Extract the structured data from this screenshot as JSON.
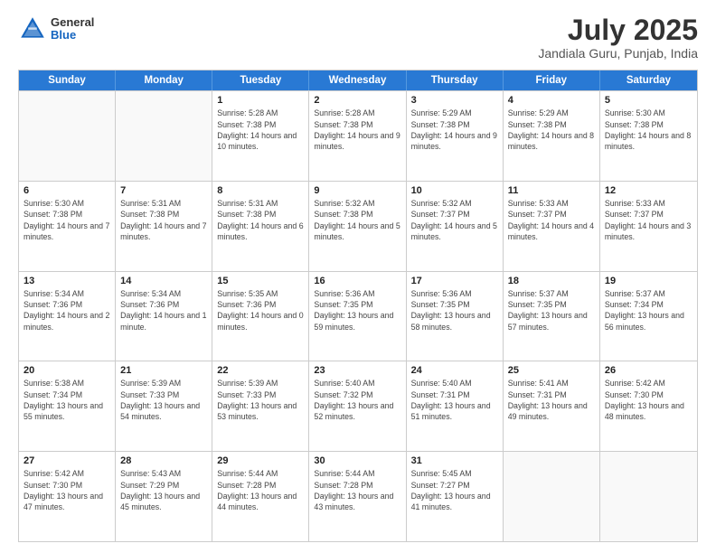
{
  "header": {
    "logo_general": "General",
    "logo_blue": "Blue",
    "main_title": "July 2025",
    "sub_title": "Jandiala Guru, Punjab, India"
  },
  "days_of_week": [
    "Sunday",
    "Monday",
    "Tuesday",
    "Wednesday",
    "Thursday",
    "Friday",
    "Saturday"
  ],
  "weeks": [
    [
      {
        "day": "",
        "info": ""
      },
      {
        "day": "",
        "info": ""
      },
      {
        "day": "1",
        "info": "Sunrise: 5:28 AM\nSunset: 7:38 PM\nDaylight: 14 hours and 10 minutes."
      },
      {
        "day": "2",
        "info": "Sunrise: 5:28 AM\nSunset: 7:38 PM\nDaylight: 14 hours and 9 minutes."
      },
      {
        "day": "3",
        "info": "Sunrise: 5:29 AM\nSunset: 7:38 PM\nDaylight: 14 hours and 9 minutes."
      },
      {
        "day": "4",
        "info": "Sunrise: 5:29 AM\nSunset: 7:38 PM\nDaylight: 14 hours and 8 minutes."
      },
      {
        "day": "5",
        "info": "Sunrise: 5:30 AM\nSunset: 7:38 PM\nDaylight: 14 hours and 8 minutes."
      }
    ],
    [
      {
        "day": "6",
        "info": "Sunrise: 5:30 AM\nSunset: 7:38 PM\nDaylight: 14 hours and 7 minutes."
      },
      {
        "day": "7",
        "info": "Sunrise: 5:31 AM\nSunset: 7:38 PM\nDaylight: 14 hours and 7 minutes."
      },
      {
        "day": "8",
        "info": "Sunrise: 5:31 AM\nSunset: 7:38 PM\nDaylight: 14 hours and 6 minutes."
      },
      {
        "day": "9",
        "info": "Sunrise: 5:32 AM\nSunset: 7:38 PM\nDaylight: 14 hours and 5 minutes."
      },
      {
        "day": "10",
        "info": "Sunrise: 5:32 AM\nSunset: 7:37 PM\nDaylight: 14 hours and 5 minutes."
      },
      {
        "day": "11",
        "info": "Sunrise: 5:33 AM\nSunset: 7:37 PM\nDaylight: 14 hours and 4 minutes."
      },
      {
        "day": "12",
        "info": "Sunrise: 5:33 AM\nSunset: 7:37 PM\nDaylight: 14 hours and 3 minutes."
      }
    ],
    [
      {
        "day": "13",
        "info": "Sunrise: 5:34 AM\nSunset: 7:36 PM\nDaylight: 14 hours and 2 minutes."
      },
      {
        "day": "14",
        "info": "Sunrise: 5:34 AM\nSunset: 7:36 PM\nDaylight: 14 hours and 1 minute."
      },
      {
        "day": "15",
        "info": "Sunrise: 5:35 AM\nSunset: 7:36 PM\nDaylight: 14 hours and 0 minutes."
      },
      {
        "day": "16",
        "info": "Sunrise: 5:36 AM\nSunset: 7:35 PM\nDaylight: 13 hours and 59 minutes."
      },
      {
        "day": "17",
        "info": "Sunrise: 5:36 AM\nSunset: 7:35 PM\nDaylight: 13 hours and 58 minutes."
      },
      {
        "day": "18",
        "info": "Sunrise: 5:37 AM\nSunset: 7:35 PM\nDaylight: 13 hours and 57 minutes."
      },
      {
        "day": "19",
        "info": "Sunrise: 5:37 AM\nSunset: 7:34 PM\nDaylight: 13 hours and 56 minutes."
      }
    ],
    [
      {
        "day": "20",
        "info": "Sunrise: 5:38 AM\nSunset: 7:34 PM\nDaylight: 13 hours and 55 minutes."
      },
      {
        "day": "21",
        "info": "Sunrise: 5:39 AM\nSunset: 7:33 PM\nDaylight: 13 hours and 54 minutes."
      },
      {
        "day": "22",
        "info": "Sunrise: 5:39 AM\nSunset: 7:33 PM\nDaylight: 13 hours and 53 minutes."
      },
      {
        "day": "23",
        "info": "Sunrise: 5:40 AM\nSunset: 7:32 PM\nDaylight: 13 hours and 52 minutes."
      },
      {
        "day": "24",
        "info": "Sunrise: 5:40 AM\nSunset: 7:31 PM\nDaylight: 13 hours and 51 minutes."
      },
      {
        "day": "25",
        "info": "Sunrise: 5:41 AM\nSunset: 7:31 PM\nDaylight: 13 hours and 49 minutes."
      },
      {
        "day": "26",
        "info": "Sunrise: 5:42 AM\nSunset: 7:30 PM\nDaylight: 13 hours and 48 minutes."
      }
    ],
    [
      {
        "day": "27",
        "info": "Sunrise: 5:42 AM\nSunset: 7:30 PM\nDaylight: 13 hours and 47 minutes."
      },
      {
        "day": "28",
        "info": "Sunrise: 5:43 AM\nSunset: 7:29 PM\nDaylight: 13 hours and 45 minutes."
      },
      {
        "day": "29",
        "info": "Sunrise: 5:44 AM\nSunset: 7:28 PM\nDaylight: 13 hours and 44 minutes."
      },
      {
        "day": "30",
        "info": "Sunrise: 5:44 AM\nSunset: 7:28 PM\nDaylight: 13 hours and 43 minutes."
      },
      {
        "day": "31",
        "info": "Sunrise: 5:45 AM\nSunset: 7:27 PM\nDaylight: 13 hours and 41 minutes."
      },
      {
        "day": "",
        "info": ""
      },
      {
        "day": "",
        "info": ""
      }
    ]
  ]
}
